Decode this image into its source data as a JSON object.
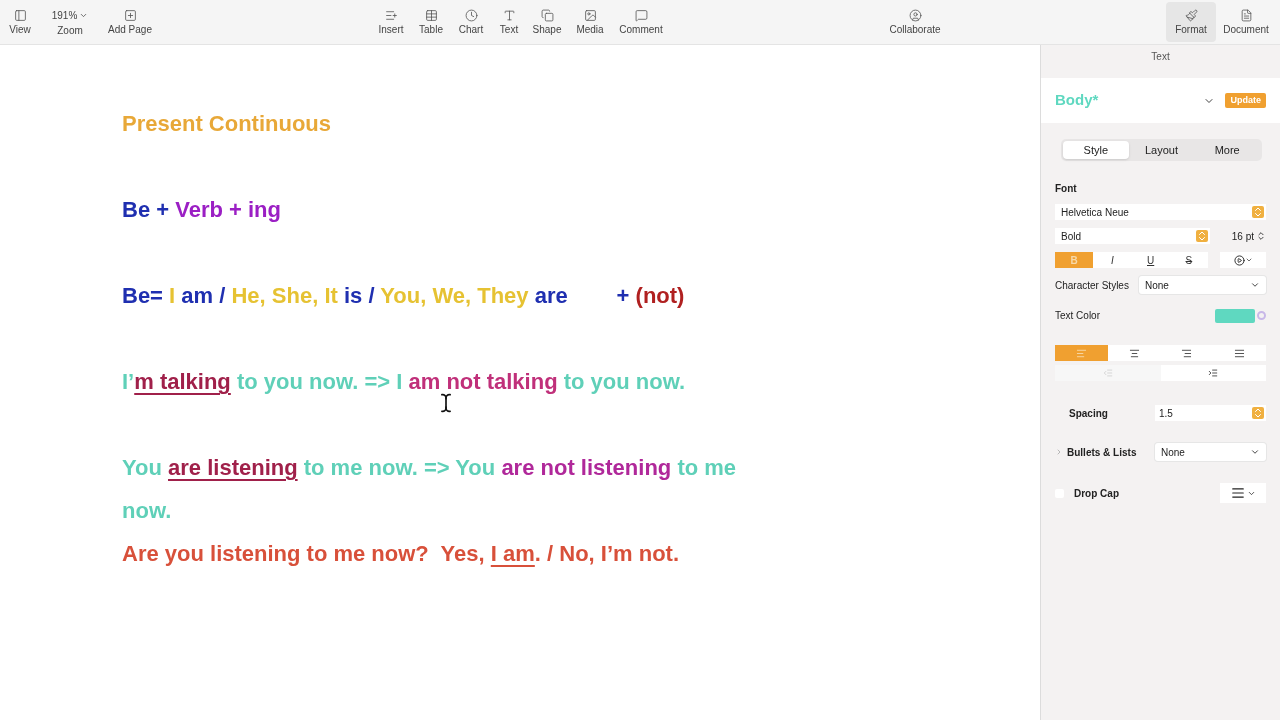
{
  "toolbar": {
    "items": [
      {
        "kind": "button",
        "label": "View",
        "selected": false
      },
      {
        "kind": "zoom",
        "label": "Zoom",
        "value": "191%",
        "selected": false
      },
      {
        "kind": "button",
        "label": "Add Page",
        "selected": false
      },
      {
        "kind": "button",
        "label": "Insert",
        "selected": false
      },
      {
        "kind": "button",
        "label": "Table",
        "selected": false
      },
      {
        "kind": "button",
        "label": "Chart",
        "selected": false
      },
      {
        "kind": "button",
        "label": "Text",
        "selected": false
      },
      {
        "kind": "button",
        "label": "Shape",
        "selected": false
      },
      {
        "kind": "button",
        "label": "Media",
        "selected": false
      },
      {
        "kind": "button",
        "label": "Comment",
        "selected": false
      },
      {
        "kind": "button",
        "label": "Collaborate",
        "selected": false
      },
      {
        "kind": "button",
        "label": "Format",
        "selected": true
      },
      {
        "kind": "button",
        "label": "Document",
        "selected": false
      }
    ]
  },
  "document": {
    "paragraphs": [
      {
        "segments": [
          {
            "text": "Present Continuous",
            "color": "#e8a838",
            "underline": false
          }
        ]
      },
      {
        "segments": [
          {
            "text": "Be + ",
            "color": "#1f2fb0",
            "underline": false
          },
          {
            "text": "Verb + ing",
            "color": "#9b1fc4",
            "underline": false
          }
        ]
      },
      {
        "segments": [
          {
            "text": "Be= ",
            "color": "#1f2fb0",
            "underline": false
          },
          {
            "text": "I",
            "color": "#e6c232",
            "underline": false
          },
          {
            "text": " am / ",
            "color": "#1f2fb0",
            "underline": false
          },
          {
            "text": "He, She, It",
            "color": "#e6c232",
            "underline": false
          },
          {
            "text": " is / ",
            "color": "#1f2fb0",
            "underline": false
          },
          {
            "text": "You, We, They",
            "color": "#e6c232",
            "underline": false
          },
          {
            "text": " are        + ",
            "color": "#1f2fb0",
            "underline": false
          },
          {
            "text": "(not)",
            "color": "#b02020",
            "underline": false
          }
        ]
      },
      {
        "segments": [
          {
            "text": "I’",
            "color": "#5fd0b8",
            "underline": false
          },
          {
            "text": "m talking",
            "color": "#a0204a",
            "underline": true
          },
          {
            "text": " to you now. => I ",
            "color": "#5fd0b8",
            "underline": false
          },
          {
            "text": "am not talking",
            "color": "#c0307a",
            "underline": false
          },
          {
            "text": " to you now.",
            "color": "#5fd0b8",
            "underline": false
          }
        ]
      },
      {
        "segments": [
          {
            "text": "You ",
            "color": "#5fd0b8",
            "underline": false
          },
          {
            "text": "are listening",
            "color": "#a0204a",
            "underline": true
          },
          {
            "text": " to me now. => You ",
            "color": "#5fd0b8",
            "underline": false
          },
          {
            "text": "are not listening",
            "color": "#b0289a",
            "underline": false
          },
          {
            "text": " to me now.",
            "color": "#5fd0b8",
            "underline": false
          }
        ]
      },
      {
        "segments": [
          {
            "text": "Are you listening to me now?  Yes, ",
            "color": "#d8503a",
            "underline": false
          },
          {
            "text": "I am",
            "color": "#d8503a",
            "underline": true
          },
          {
            "text": ". / No, I’m not.",
            "color": "#d8503a",
            "underline": false
          }
        ]
      }
    ]
  },
  "sidebar": {
    "title": "Text",
    "paragraph_style": "Body*",
    "update_button": "Update",
    "tabs": [
      {
        "label": "Style",
        "selected": true
      },
      {
        "label": "Layout",
        "selected": false
      },
      {
        "label": "More",
        "selected": false
      }
    ],
    "font_label": "Font",
    "font_family": "Helvetica Neue",
    "typeface": "Bold",
    "size": "16 pt",
    "style_buttons": [
      {
        "label": "B",
        "selected": true
      },
      {
        "label": "I",
        "selected": false
      },
      {
        "label": "U",
        "selected": false
      },
      {
        "label": "S",
        "selected": false
      }
    ],
    "character_styles": {
      "label": "Character Styles",
      "value": "None"
    },
    "text_color": {
      "label": "Text Color",
      "color": "#5fd8c0"
    },
    "alignment": [
      {
        "selected": true
      },
      {
        "selected": false
      },
      {
        "selected": false
      },
      {
        "selected": false
      }
    ],
    "indent": [
      {
        "disabled": true
      },
      {
        "disabled": false
      }
    ],
    "spacing": {
      "label": "Spacing",
      "value": "1.5"
    },
    "bullets": {
      "label": "Bullets & Lists",
      "value": "None"
    },
    "drop_cap": {
      "label": "Drop Cap",
      "checked": false
    }
  }
}
